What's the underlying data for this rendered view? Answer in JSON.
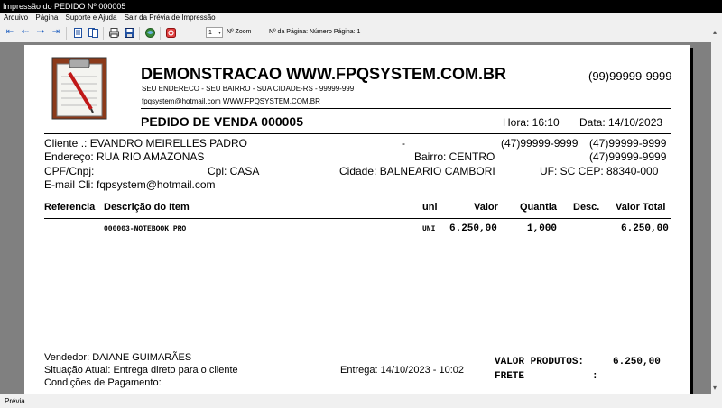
{
  "window": {
    "title": "Impressão do PEDIDO Nº 000005"
  },
  "menu": {
    "items": [
      {
        "label": "Arquivo"
      },
      {
        "label": "Página"
      },
      {
        "label": "Suporte e Ajuda"
      },
      {
        "label": "Sair da Prévia de Impressão"
      }
    ]
  },
  "toolbar": {
    "zoom_value": "1",
    "zoom_label": "Nº Zoom",
    "page_label": "Nº da Página: Número Página: 1",
    "icons": [
      "first-page-icon",
      "prev-page-icon",
      "next-page-icon",
      "last-page-icon",
      "single-page-icon",
      "two-pages-icon",
      "print-icon",
      "save-icon",
      "export-icon",
      "close-icon"
    ]
  },
  "report": {
    "company_name": "DEMONSTRACAO WWW.FPQSYSTEM.COM.BR",
    "company_phone": "(99)99999-9999",
    "company_address": "SEU ENDERECO - SEU BAIRRO - SUA CIDADE-RS - 99999-999",
    "company_contact": "fpqsystem@hotmail.com  WWW.FPQSYSTEM.COM.BR",
    "order_title": "PEDIDO DE VENDA 000005",
    "hour_label": "Hora: 16:10",
    "date_label": "Data: 14/10/2023",
    "client": {
      "name_line": "Cliente   .: EVANDRO MEIRELLES PADRO",
      "dash": "-",
      "phone1": "(47)99999-9999",
      "phone2": "(47)99999-9999",
      "address": "Endereço: RUA RIO AMAZONAS",
      "bairro": "Bairro: CENTRO",
      "phone3": "(47)99999-9999",
      "cpf": "CPF/Cnpj:",
      "cpl": "Cpl: CASA",
      "cidade": "Cidade: BALNEARIO CAMBORI",
      "uf_cep": "UF: SC CEP: 88340-000",
      "email": "E-mail Cli: fqpsystem@hotmail.com"
    },
    "table": {
      "headers": {
        "ref": "Referencia",
        "desc": "Descrição do Item",
        "uni": "uni",
        "valor": "Valor",
        "qtd": "Quantia",
        "desconto": "Desc.",
        "total": "Valor Total"
      },
      "rows": [
        {
          "desc": "000003-NOTEBOOK PRO",
          "uni": "UNI",
          "valor": "6.250,00",
          "qtd": "1,000",
          "total": "6.250,00"
        }
      ]
    },
    "footer": {
      "vendedor": "Vendedor: DAIANE GUIMARÃES",
      "situacao": "Situação Atual: Entrega direto para o cliente",
      "entrega": "Entrega: 14/10/2023 - 10:02",
      "condicoes": "Condições de Pagamento:",
      "valor_produtos_label": "VALOR PRODUTOS:",
      "valor_produtos": "6.250,00",
      "frete_label": "FRETE",
      "frete_colon": ":"
    }
  },
  "status": {
    "text": "Prévia"
  }
}
